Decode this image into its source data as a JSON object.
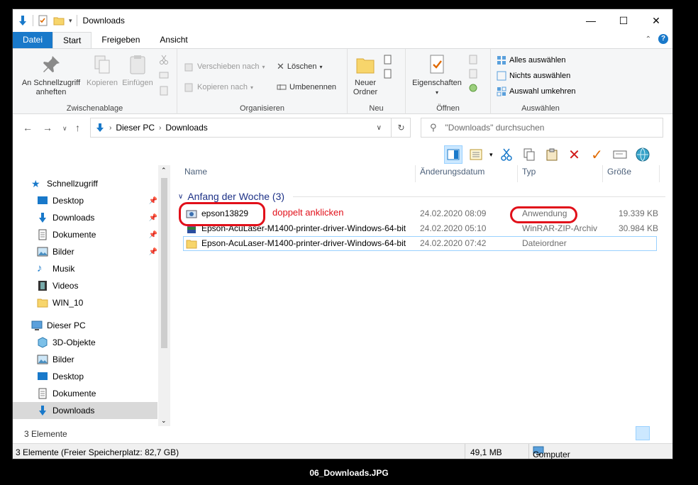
{
  "window": {
    "title": "Downloads"
  },
  "tabs": [
    "Datei",
    "Start",
    "Freigeben",
    "Ansicht"
  ],
  "ribbon": {
    "clipboard": {
      "pin": "An Schnellzugriff anheften",
      "copy": "Kopieren",
      "paste": "Einfügen",
      "label": "Zwischenablage"
    },
    "organize": {
      "move": "Verschieben nach",
      "copy_to": "Kopieren nach",
      "delete": "Löschen",
      "rename": "Umbenennen",
      "label": "Organisieren"
    },
    "new": {
      "folder": "Neuer Ordner",
      "label": "Neu"
    },
    "open": {
      "props": "Eigenschaften",
      "label": "Öffnen"
    },
    "select": {
      "all": "Alles auswählen",
      "none": "Nichts auswählen",
      "invert": "Auswahl umkehren",
      "label": "Auswählen"
    }
  },
  "address": {
    "pc": "Dieser PC",
    "folder": "Downloads"
  },
  "search": {
    "placeholder": "\"Downloads\" durchsuchen"
  },
  "nav": {
    "quick": "Schnellzugriff",
    "items": [
      "Desktop",
      "Downloads",
      "Dokumente",
      "Bilder",
      "Musik",
      "Videos",
      "WIN_10"
    ],
    "thispc": "Dieser PC",
    "pcitems": [
      "3D-Objekte",
      "Bilder",
      "Desktop",
      "Dokumente",
      "Downloads"
    ]
  },
  "columns": {
    "name": "Name",
    "date": "Änderungsdatum",
    "type": "Typ",
    "size": "Größe"
  },
  "group": "Anfang der Woche (3)",
  "files": [
    {
      "name": "epson13829",
      "date": "24.02.2020 08:09",
      "type": "Anwendung",
      "size": "19.339 KB"
    },
    {
      "name": "Epson-AcuLaser-M1400-printer-driver-Windows-64-bit",
      "date": "24.02.2020 05:10",
      "type": "WinRAR-ZIP-Archiv",
      "size": "30.984 KB"
    },
    {
      "name": "Epson-AcuLaser-M1400-printer-driver-Windows-64-bit",
      "date": "24.02.2020 07:42",
      "type": "Dateiordner",
      "size": ""
    }
  ],
  "annotation": "doppelt anklicken",
  "count": "3 Elemente",
  "status": {
    "left": "3 Elemente (Freier Speicherplatz: 82,7 GB)",
    "size": "49,1 MB",
    "computer": "Computer"
  },
  "caption": "06_Downloads.JPG"
}
